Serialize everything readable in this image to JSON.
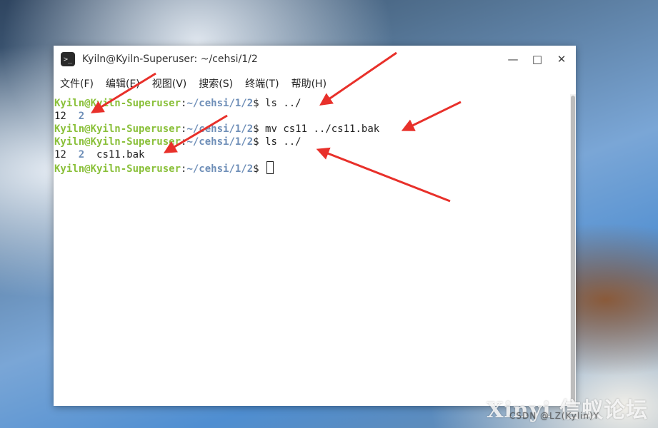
{
  "window": {
    "title": "Kyiln@Kyiln-Superuser: ~/cehsi/1/2",
    "icon": "terminal-icon",
    "controls": {
      "minimize": "—",
      "maximize": "□",
      "close": "✕"
    }
  },
  "menu": [
    "文件(F)",
    "编辑(E)",
    "视图(V)",
    "搜索(S)",
    "终端(T)",
    "帮助(H)"
  ],
  "terminal": {
    "user": "Kyiln@Kyiln-Superuser",
    "path": "~/cehsi/1/2",
    "lines": [
      {
        "type": "prompt",
        "cmd": "ls ../"
      },
      {
        "type": "output",
        "items": [
          {
            "text": "12",
            "dir": false
          },
          {
            "text": "2",
            "dir": true
          }
        ]
      },
      {
        "type": "prompt",
        "cmd": "mv cs11 ../cs11.bak"
      },
      {
        "type": "prompt",
        "cmd": "ls ../"
      },
      {
        "type": "output",
        "items": [
          {
            "text": "12",
            "dir": false
          },
          {
            "text": "2",
            "dir": true
          },
          {
            "text": "cs11.bak",
            "dir": false
          }
        ]
      },
      {
        "type": "prompt",
        "cmd": "",
        "cursor": true
      }
    ]
  },
  "colors": {
    "user": "#8ac03a",
    "path": "#6f8fb8",
    "annotation": "#e8302a"
  },
  "watermark": {
    "main": "Xinyi 信蚁论坛",
    "sub": "CSDN @LZ(Kylin)Y"
  }
}
